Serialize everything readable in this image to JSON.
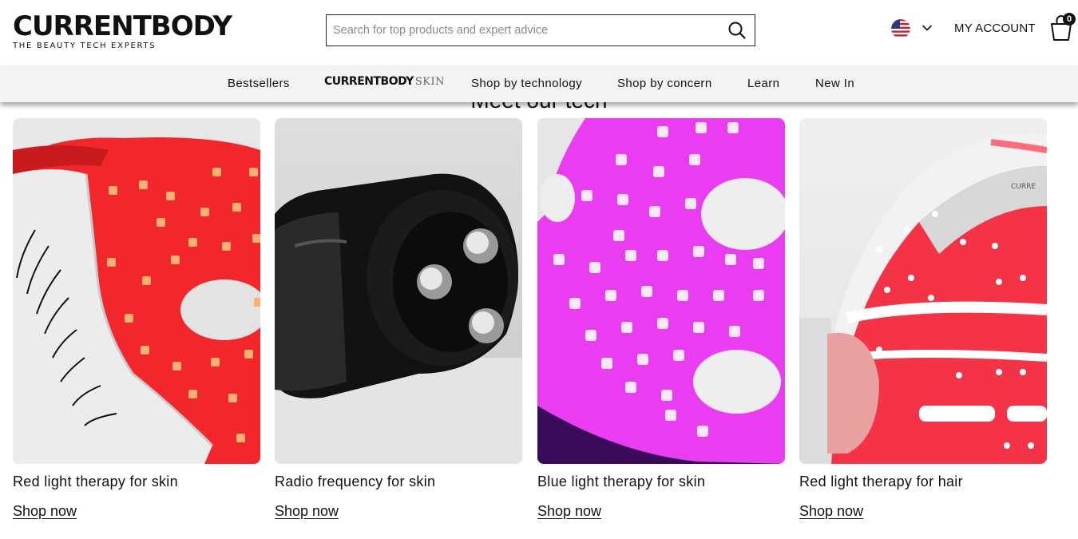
{
  "brand": {
    "name": "CURRENTBODY",
    "tagline": "THE BEAUTY TECH EXPERTS"
  },
  "search": {
    "placeholder": "Search for top products and expert advice"
  },
  "header": {
    "account_label": "MY ACCOUNT",
    "cart_count": "0",
    "locale_flag": "us-flag-icon"
  },
  "nav": {
    "items": [
      {
        "label": "Bestsellers"
      },
      {
        "label": "CURRENTBODY",
        "suffix": "SKIN"
      },
      {
        "label": "Shop by technology"
      },
      {
        "label": "Shop by concern"
      },
      {
        "label": "Learn"
      },
      {
        "label": "New In"
      }
    ]
  },
  "section": {
    "title": "Meet our tech"
  },
  "cards": [
    {
      "title": "Red light therapy for skin",
      "link": "Shop now"
    },
    {
      "title": "Radio frequency for skin",
      "link": "Shop now"
    },
    {
      "title": "Blue light therapy for skin",
      "link": "Shop now"
    },
    {
      "title": "Red light therapy for hair",
      "link": "Shop now"
    }
  ],
  "colors": {
    "accent_red": "#f2272c",
    "accent_pink": "#e020e8",
    "text": "#111111",
    "nav_bg": "#f3f3f3"
  }
}
